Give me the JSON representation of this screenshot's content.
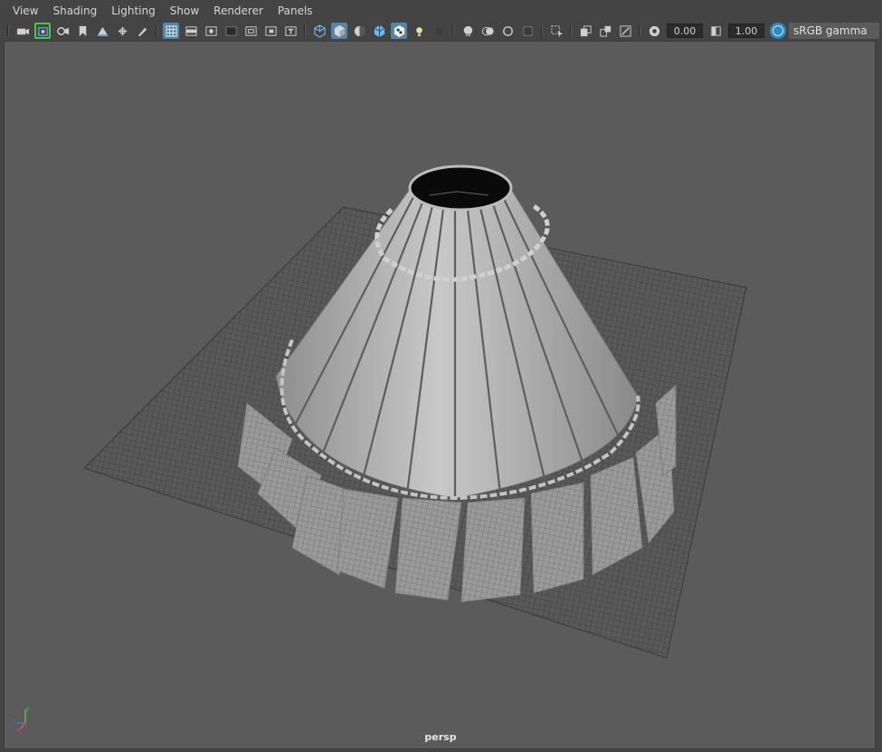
{
  "menu": {
    "items": [
      "View",
      "Shading",
      "Lighting",
      "Show",
      "Renderer",
      "Panels"
    ]
  },
  "toolbar": {
    "exposure_value": "0.00",
    "gamma_value": "1.00",
    "color_space": "sRGB gamma"
  },
  "viewport": {
    "camera_label": "persp",
    "axis": {
      "x": "x",
      "y": "y",
      "z": "z"
    }
  },
  "colors": {
    "accent": "#5285a6",
    "selected_outline": "#49c54a",
    "viewport_bg": "#5b5b5b",
    "ui_bg": "#444444"
  }
}
